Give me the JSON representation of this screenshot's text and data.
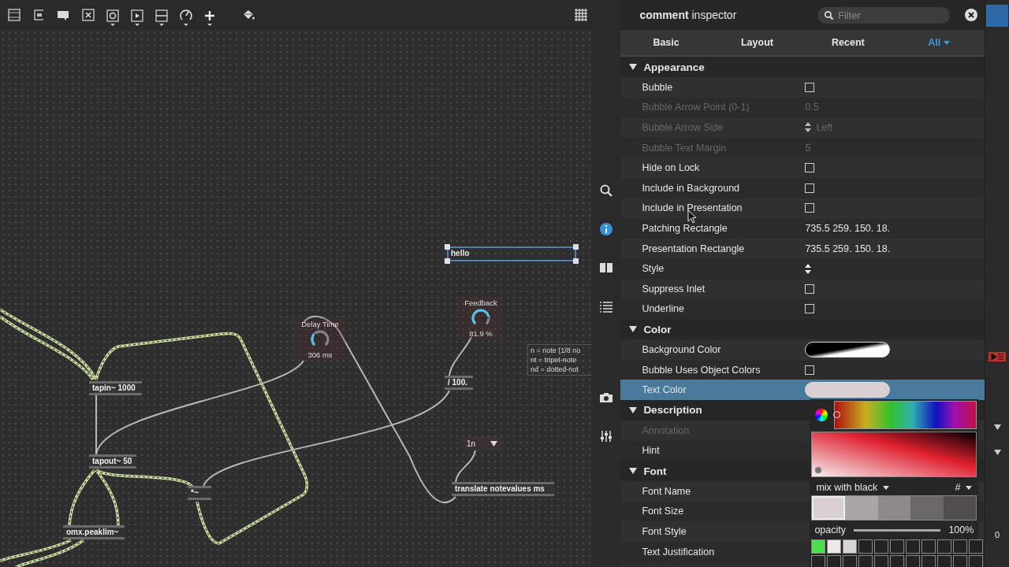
{
  "patcher": {
    "comments": [
      {
        "text": "hello",
        "selected": true
      }
    ],
    "dials": [
      {
        "label": "Delay Time",
        "reading": "306 ms"
      },
      {
        "label": "Feedback",
        "reading": "81.9 %"
      }
    ],
    "note_lines": [
      "n = note (1/8 no",
      "nt = tripet-note",
      "nd = dotted-not"
    ],
    "objects": [
      {
        "text": "tapin~ 1000"
      },
      {
        "text": "tapout~ 50"
      },
      {
        "text": "omx.peaklim~"
      },
      {
        "text": "*~"
      },
      {
        "text": "/ 100."
      },
      {
        "text": "translate notevalues ms"
      }
    ],
    "menu": {
      "value": "1n"
    }
  },
  "inspector": {
    "object": "comment",
    "title": "inspector",
    "filter": {
      "placeholder": "Filter"
    },
    "tabs": [
      {
        "label": "Basic",
        "selected": false
      },
      {
        "label": "Layout",
        "selected": false
      },
      {
        "label": "Recent",
        "selected": false
      },
      {
        "label": "All",
        "selected": true
      }
    ],
    "sections": [
      {
        "title": "Appearance",
        "expanded": true,
        "rows": [
          {
            "label": "Bubble",
            "kind": "checkbox",
            "checked": false,
            "disabled": false,
            "selected": false
          },
          {
            "label": "Bubble Arrow Point (0-1)",
            "kind": "text",
            "value": "0.5",
            "disabled": true,
            "selected": false
          },
          {
            "label": "Bubble Arrow Side",
            "kind": "stepper",
            "value": "Left",
            "disabled": true,
            "selected": false
          },
          {
            "label": "Bubble Text Margin",
            "kind": "text",
            "value": "5",
            "disabled": true,
            "selected": false
          },
          {
            "label": "Hide on Lock",
            "kind": "checkbox",
            "checked": false,
            "disabled": false,
            "selected": false
          },
          {
            "label": "Include in Background",
            "kind": "checkbox",
            "checked": false,
            "disabled": false,
            "selected": false
          },
          {
            "label": "Include in Presentation",
            "kind": "checkbox",
            "checked": false,
            "disabled": false,
            "selected": false
          },
          {
            "label": "Patching Rectangle",
            "kind": "text",
            "value": "735.5 259. 150. 18.",
            "disabled": false,
            "selected": false
          },
          {
            "label": "Presentation Rectangle",
            "kind": "text",
            "value": "735.5 259. 150. 18.",
            "disabled": false,
            "selected": false
          },
          {
            "label": "Style",
            "kind": "stepper",
            "disabled": false,
            "selected": false
          },
          {
            "label": "Suppress Inlet",
            "kind": "checkbox",
            "checked": false,
            "disabled": false,
            "selected": false
          },
          {
            "label": "Underline",
            "kind": "checkbox",
            "checked": false,
            "disabled": false,
            "selected": false
          }
        ]
      },
      {
        "title": "Color",
        "expanded": true,
        "rows": [
          {
            "label": "Background Color",
            "kind": "gradient",
            "disabled": false,
            "selected": false
          },
          {
            "label": "Bubble Uses Object Colors",
            "kind": "checkbox",
            "checked": false,
            "disabled": false,
            "selected": false
          },
          {
            "label": "Text Color",
            "kind": "swatch",
            "color": "#d8cfd2",
            "disabled": false,
            "selected": true
          }
        ]
      },
      {
        "title": "Description",
        "expanded": true,
        "rows": [
          {
            "label": "Annotation",
            "kind": "text",
            "disabled": true,
            "selected": false
          },
          {
            "label": "Hint",
            "kind": "text",
            "disabled": false,
            "selected": false
          }
        ]
      },
      {
        "title": "Font",
        "expanded": true,
        "rows": [
          {
            "label": "Font Name",
            "kind": "text",
            "disabled": false,
            "selected": false
          },
          {
            "label": "Font Size",
            "kind": "text",
            "disabled": false,
            "selected": false
          },
          {
            "label": "Font Style",
            "kind": "text",
            "disabled": false,
            "selected": false
          },
          {
            "label": "Text Justification",
            "kind": "text",
            "disabled": false,
            "selected": false
          }
        ]
      }
    ]
  },
  "color_picker": {
    "mode": "mix with black",
    "format": "#",
    "shades": [
      {
        "color": "#d8cfd2",
        "selected": true
      },
      {
        "color": "#a9a5a6",
        "selected": false
      },
      {
        "color": "#8e8a8b",
        "selected": false
      },
      {
        "color": "#6a6768",
        "selected": false
      },
      {
        "color": "#4f4d4e",
        "selected": false
      }
    ],
    "opacity": {
      "label": "opacity",
      "level": 1,
      "reading": "100%"
    },
    "presets": [
      {
        "color": "#4ddd4d"
      },
      {
        "color": "#ece8ea"
      },
      {
        "color": "#d6d4d5"
      }
    ]
  },
  "side_panel": {
    "values": [
      "0"
    ]
  }
}
